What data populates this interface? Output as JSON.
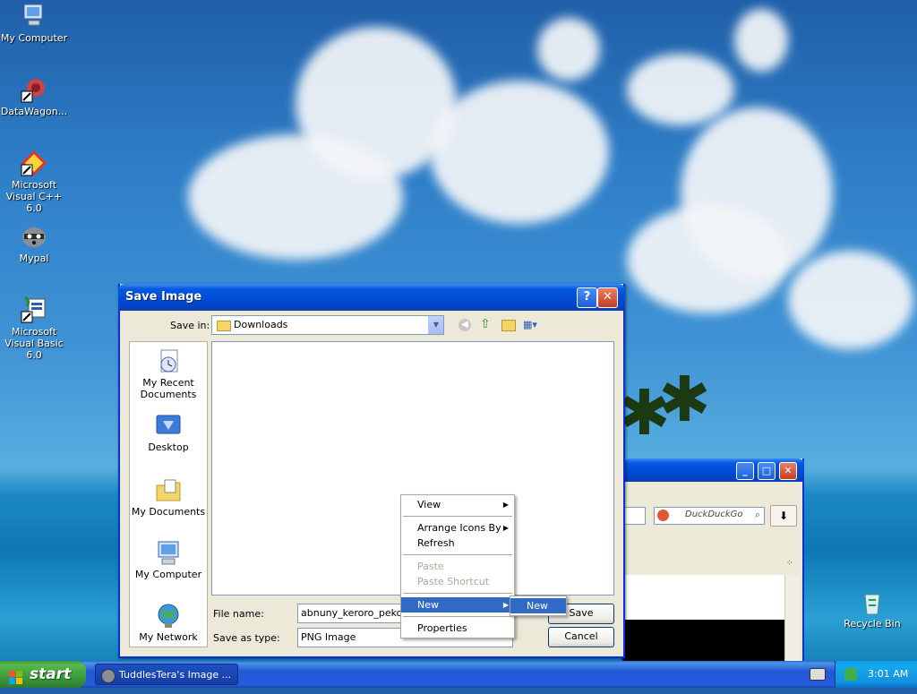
{
  "desktop": {
    "icons": [
      {
        "label": "My Computer"
      },
      {
        "label": "DataWagon..."
      },
      {
        "label": "Microsoft Visual C++ 6.0"
      },
      {
        "label": "Mypal"
      },
      {
        "label": "Microsoft Visual Basic 6.0"
      },
      {
        "label": "Recycle Bin"
      }
    ]
  },
  "dialog": {
    "title": "Save Image",
    "help_btn": "?",
    "close_btn": "✕",
    "save_in_label": "Save in:",
    "save_in_value": "Downloads",
    "places": [
      {
        "label": "My Recent Documents"
      },
      {
        "label": "Desktop"
      },
      {
        "label": "My Documents"
      },
      {
        "label": "My Computer"
      },
      {
        "label": "My Network"
      }
    ],
    "file_name_label": "File name:",
    "file_name_value": "abnuny_keroro_pekopon",
    "save_as_type_label": "Save as type:",
    "save_as_type_value": "PNG Image",
    "save_button": "Save",
    "cancel_button": "Cancel"
  },
  "context_menu": {
    "view": "View",
    "arrange": "Arrange Icons By",
    "refresh": "Refresh",
    "paste": "Paste",
    "paste_shortcut": "Paste Shortcut",
    "new": "New",
    "properties": "Properties",
    "submenu_new": "New"
  },
  "browser": {
    "search_placeholder": "DuckDuckGo"
  },
  "taskbar": {
    "start": "start",
    "task_label": "TuddlesTera's Image ...",
    "clock": "3:01 AM"
  }
}
